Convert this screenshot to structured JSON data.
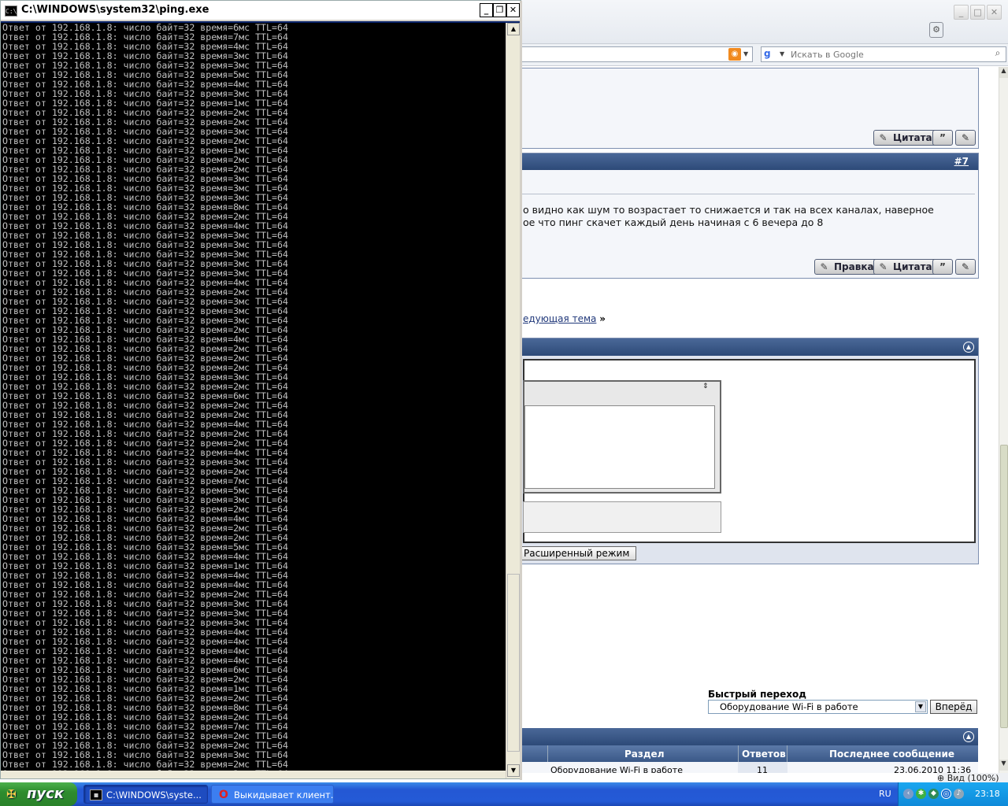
{
  "console": {
    "title": "C:\\WINDOWS\\system32\\ping.exe",
    "icon": "C:\\",
    "lines": [
      "Ответ от 192.168.1.8: число байт=32 время=6мс TTL=64",
      "Ответ от 192.168.1.8: число байт=32 время=7мс TTL=64",
      "Ответ от 192.168.1.8: число байт=32 время=4мс TTL=64",
      "Ответ от 192.168.1.8: число байт=32 время=3мс TTL=64",
      "Ответ от 192.168.1.8: число байт=32 время=3мс TTL=64",
      "Ответ от 192.168.1.8: число байт=32 время=5мс TTL=64",
      "Ответ от 192.168.1.8: число байт=32 время=4мс TTL=64",
      "Ответ от 192.168.1.8: число байт=32 время=3мс TTL=64",
      "Ответ от 192.168.1.8: число байт=32 время=1мс TTL=64",
      "Ответ от 192.168.1.8: число байт=32 время=2мс TTL=64",
      "Ответ от 192.168.1.8: число байт=32 время=2мс TTL=64",
      "Ответ от 192.168.1.8: число байт=32 время=3мс TTL=64",
      "Ответ от 192.168.1.8: число байт=32 время=2мс TTL=64",
      "Ответ от 192.168.1.8: число байт=32 время=1мс TTL=64",
      "Ответ от 192.168.1.8: число байт=32 время=2мс TTL=64",
      "Ответ от 192.168.1.8: число байт=32 время=2мс TTL=64",
      "Ответ от 192.168.1.8: число байт=32 время=3мс TTL=64",
      "Ответ от 192.168.1.8: число байт=32 время=3мс TTL=64",
      "Ответ от 192.168.1.8: число байт=32 время=3мс TTL=64",
      "Ответ от 192.168.1.8: число байт=32 время=8мс TTL=64",
      "Ответ от 192.168.1.8: число байт=32 время=2мс TTL=64",
      "Ответ от 192.168.1.8: число байт=32 время=4мс TTL=64",
      "Ответ от 192.168.1.8: число байт=32 время=3мс TTL=64",
      "Ответ от 192.168.1.8: число байт=32 время=3мс TTL=64",
      "Ответ от 192.168.1.8: число байт=32 время=3мс TTL=64",
      "Ответ от 192.168.1.8: число байт=32 время=3мс TTL=64",
      "Ответ от 192.168.1.8: число байт=32 время=3мс TTL=64",
      "Ответ от 192.168.1.8: число байт=32 время=4мс TTL=64",
      "Ответ от 192.168.1.8: число байт=32 время=2мс TTL=64",
      "Ответ от 192.168.1.8: число байт=32 время=3мс TTL=64",
      "Ответ от 192.168.1.8: число байт=32 время=3мс TTL=64",
      "Ответ от 192.168.1.8: число байт=32 время=3мс TTL=64",
      "Ответ от 192.168.1.8: число байт=32 время=2мс TTL=64",
      "Ответ от 192.168.1.8: число байт=32 время=4мс TTL=64",
      "Ответ от 192.168.1.8: число байт=32 время=2мс TTL=64",
      "Ответ от 192.168.1.8: число байт=32 время=2мс TTL=64",
      "Ответ от 192.168.1.8: число байт=32 время=2мс TTL=64",
      "Ответ от 192.168.1.8: число байт=32 время=3мс TTL=64",
      "Ответ от 192.168.1.8: число байт=32 время=2мс TTL=64",
      "Ответ от 192.168.1.8: число байт=32 время=6мс TTL=64",
      "Ответ от 192.168.1.8: число байт=32 время=2мс TTL=64",
      "Ответ от 192.168.1.8: число байт=32 время=2мс TTL=64",
      "Ответ от 192.168.1.8: число байт=32 время=4мс TTL=64",
      "Ответ от 192.168.1.8: число байт=32 время=2мс TTL=64",
      "Ответ от 192.168.1.8: число байт=32 время=2мс TTL=64",
      "Ответ от 192.168.1.8: число байт=32 время=4мс TTL=64",
      "Ответ от 192.168.1.8: число байт=32 время=3мс TTL=64",
      "Ответ от 192.168.1.8: число байт=32 время=2мс TTL=64",
      "Ответ от 192.168.1.8: число байт=32 время=7мс TTL=64",
      "Ответ от 192.168.1.8: число байт=32 время=5мс TTL=64",
      "Ответ от 192.168.1.8: число байт=32 время=3мс TTL=64",
      "Ответ от 192.168.1.8: число байт=32 время=2мс TTL=64",
      "Ответ от 192.168.1.8: число байт=32 время=4мс TTL=64",
      "Ответ от 192.168.1.8: число байт=32 время=2мс TTL=64",
      "Ответ от 192.168.1.8: число байт=32 время=2мс TTL=64",
      "Ответ от 192.168.1.8: число байт=32 время=5мс TTL=64",
      "Ответ от 192.168.1.8: число байт=32 время=4мс TTL=64",
      "Ответ от 192.168.1.8: число байт=32 время=1мс TTL=64",
      "Ответ от 192.168.1.8: число байт=32 время=4мс TTL=64",
      "Ответ от 192.168.1.8: число байт=32 время=4мс TTL=64",
      "Ответ от 192.168.1.8: число байт=32 время=2мс TTL=64",
      "Ответ от 192.168.1.8: число байт=32 время=3мс TTL=64",
      "Ответ от 192.168.1.8: число байт=32 время=3мс TTL=64",
      "Ответ от 192.168.1.8: число байт=32 время=3мс TTL=64",
      "Ответ от 192.168.1.8: число байт=32 время=4мс TTL=64",
      "Ответ от 192.168.1.8: число байт=32 время=4мс TTL=64",
      "Ответ от 192.168.1.8: число байт=32 время=4мс TTL=64",
      "Ответ от 192.168.1.8: число байт=32 время=4мс TTL=64",
      "Ответ от 192.168.1.8: число байт=32 время=6мс TTL=64",
      "Ответ от 192.168.1.8: число байт=32 время=2мс TTL=64",
      "Ответ от 192.168.1.8: число байт=32 время=1мс TTL=64",
      "Ответ от 192.168.1.8: число байт=32 время=2мс TTL=64",
      "Ответ от 192.168.1.8: число байт=32 время=8мс TTL=64",
      "Ответ от 192.168.1.8: число байт=32 время=2мс TTL=64",
      "Ответ от 192.168.1.8: число байт=32 время=7мс TTL=64",
      "Ответ от 192.168.1.8: число байт=32 время=2мс TTL=64",
      "Ответ от 192.168.1.8: число байт=32 время=2мс TTL=64",
      "Ответ от 192.168.1.8: число байт=32 время=3мс TTL=64",
      "Ответ от 192.168.1.8: число байт=32 время=2мс TTL=64",
      "Ответ от 192.168.1.8: число байт=32 время=3мс TTL=64"
    ]
  },
  "browser": {
    "search_placeholder": "Искать в Google",
    "post7_number": "#7",
    "post_text_line1": "о видно как шум то возрастает то снижается и так на всех каналах, наверное",
    "post_text_line2": "ое что пинг скачет каждый день начиная с 6 вечера до 8",
    "button_edit": "Правка",
    "button_quote": "Цитата",
    "next_topic": "едующая тема",
    "next_topic_arrow": "»",
    "advanced_mode": "Расширенный режим",
    "quick_jump_label": "Быстрый переход",
    "quick_jump_value": "Оборудование Wi-Fi в работе",
    "quick_jump_go": "Вперёд",
    "table_headers": [
      "Раздел",
      "Ответов",
      "Последнее сообщение"
    ],
    "table_row_partial": [
      "Оборудование Wi-Fi в работе",
      "11",
      "23.06.2010 11:36"
    ],
    "zoom": "Вид (100%)"
  },
  "taskbar": {
    "start": "пуск",
    "tasks": [
      "C:\\WINDOWS\\syste...",
      "Выкидывает клиент..."
    ],
    "lang": "RU",
    "clock": "23:18"
  }
}
